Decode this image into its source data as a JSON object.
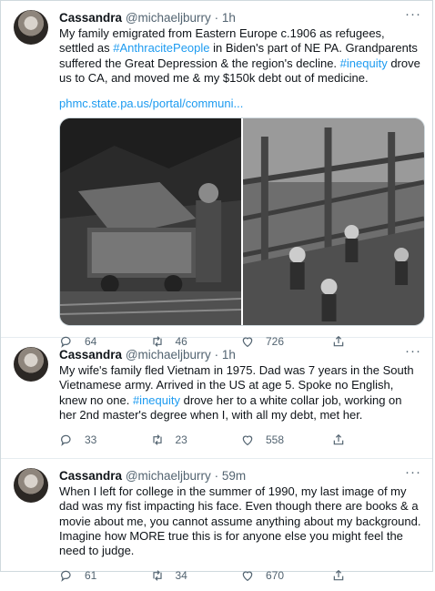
{
  "tweets": [
    {
      "name": "Cassandra",
      "handle": "@michaeljburry",
      "sep": "·",
      "time": "1h",
      "more": "···",
      "text_parts": [
        "My family emigrated from Eastern Europe c.1906 as refugees, settled as ",
        "#AnthracitePeople",
        " in Biden's part of NE PA.  Grandparents suffered the Great Depression & the region's decline. ",
        "#inequity",
        " drove us to CA, and moved me & my $150k debt out of medicine."
      ],
      "link": "phmc.state.pa.us/portal/communi...",
      "counts": {
        "reply": "64",
        "retweet": "46",
        "like": "726"
      }
    },
    {
      "name": "Cassandra",
      "handle": "@michaeljburry",
      "sep": "·",
      "time": "1h",
      "more": "···",
      "text_parts": [
        "My wife's family fled Vietnam in 1975. Dad was 7 years in the South Vietnamese army. Arrived in the US at age 5. Spoke no English, knew no one. ",
        "#inequity",
        " drove her to a white collar job, working on her 2nd master's degree when I, with all my debt, met her."
      ],
      "counts": {
        "reply": "33",
        "retweet": "23",
        "like": "558"
      }
    },
    {
      "name": "Cassandra",
      "handle": "@michaeljburry",
      "sep": "·",
      "time": "59m",
      "more": "···",
      "text_parts": [
        "When I left for college in the summer of 1990, my last image of my dad was my fist impacting his face.  Even though there are books &  a movie about me, you cannot assume anything about my background. Imagine how MORE true this is for anyone else you might feel the need to judge."
      ],
      "counts": {
        "reply": "61",
        "retweet": "34",
        "like": "670"
      }
    }
  ],
  "colors": {
    "link": "#1d9bf0",
    "meta": "#536471",
    "divider": "#e6ecf0"
  },
  "icons": [
    "reply-icon",
    "retweet-icon",
    "like-icon",
    "share-icon",
    "more-icon"
  ]
}
